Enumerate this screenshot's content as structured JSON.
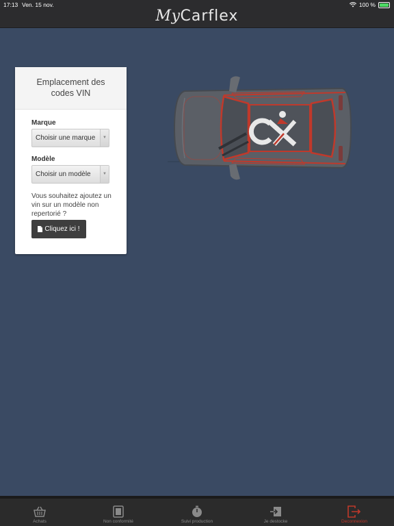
{
  "status": {
    "time": "17:13",
    "date": "Ven. 15 nov.",
    "battery": "100 %"
  },
  "header": {
    "logo_my": "My",
    "logo_brand": "Carflex"
  },
  "panel": {
    "title_line1": "Emplacement des",
    "title_line2": "codes VIN",
    "marque_label": "Marque",
    "marque_value": "Choisir une marque",
    "modele_label": "Modèle",
    "modele_value": "Choisir un modèle",
    "note": "Vous souhaitez ajoutez un vin sur un modèle non repertorié ?",
    "button_label": "Cliquez ici !"
  },
  "car": {
    "badge": "CX"
  },
  "tabs": [
    {
      "label": "Achats",
      "icon": "basket-icon"
    },
    {
      "label": "Non conformité",
      "icon": "document-icon"
    },
    {
      "label": "Suivi production",
      "icon": "stopwatch-icon"
    },
    {
      "label": "Je destocke",
      "icon": "import-icon"
    },
    {
      "label": "Deconnexion",
      "icon": "logout-icon"
    }
  ],
  "colors": {
    "background": "#3a4a63",
    "bar": "#2c2c2e",
    "accent_red": "#c0392b",
    "battery": "#4cd964"
  }
}
